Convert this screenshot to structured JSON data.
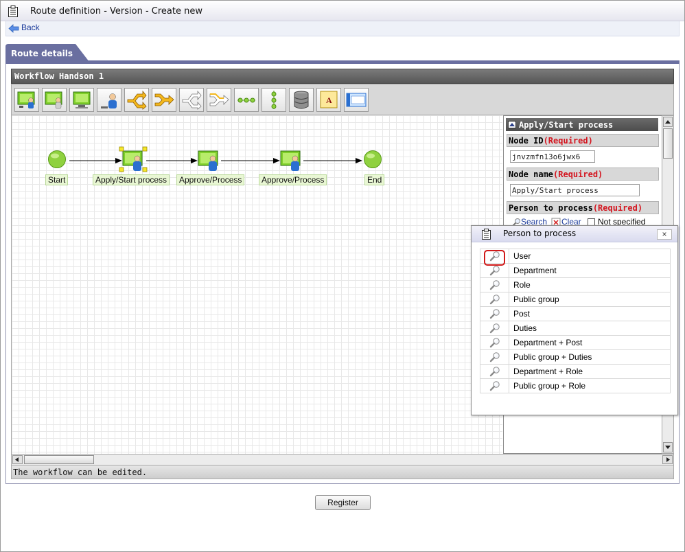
{
  "window": {
    "title": "Route definition - Version - Create new"
  },
  "nav": {
    "back_label": "Back"
  },
  "tab": {
    "label": "Route details"
  },
  "workflow": {
    "name": "Workflow Handson 1",
    "toolbar_tools": [
      "apply-node-icon",
      "approve-node-icon",
      "screen-node-icon",
      "user-node-icon",
      "branch-start-icon",
      "branch-end-icon",
      "parallel-branch-icon",
      "merge-icon",
      "sequence-icon",
      "vertical-sequence-icon",
      "database-icon",
      "text-annotation-icon",
      "frame-icon"
    ],
    "nodes": [
      {
        "label": "Start",
        "kind": "start"
      },
      {
        "label": "Apply/Start process",
        "kind": "apply",
        "selected": true
      },
      {
        "label": "Approve/Process",
        "kind": "approve"
      },
      {
        "label": "Approve/Process",
        "kind": "approve"
      },
      {
        "label": "End",
        "kind": "end"
      }
    ],
    "status": "The workflow can be edited."
  },
  "properties": {
    "header": "Apply/Start process",
    "node_id_label": "Node ID",
    "required_label": "(Required)",
    "node_id_value": "jnvzmfn13o6jwx6",
    "node_name_label": "Node name",
    "node_name_value": "Apply/Start process",
    "person_label": "Person to process",
    "search_label": "Search",
    "clear_label": "Clear",
    "not_specified_label": "Not specified"
  },
  "popup": {
    "title": "Person to process",
    "close_label": "×",
    "items": [
      "User",
      "Department",
      "Role",
      "Public group",
      "Post",
      "Duties",
      "Department + Post",
      "Public group + Duties",
      "Department + Role",
      "Public group + Role"
    ]
  },
  "footer": {
    "register_label": "Register"
  },
  "colors": {
    "accent": "#6a6fa0",
    "required": "#d4141e",
    "node_green": "#8fd13f"
  }
}
